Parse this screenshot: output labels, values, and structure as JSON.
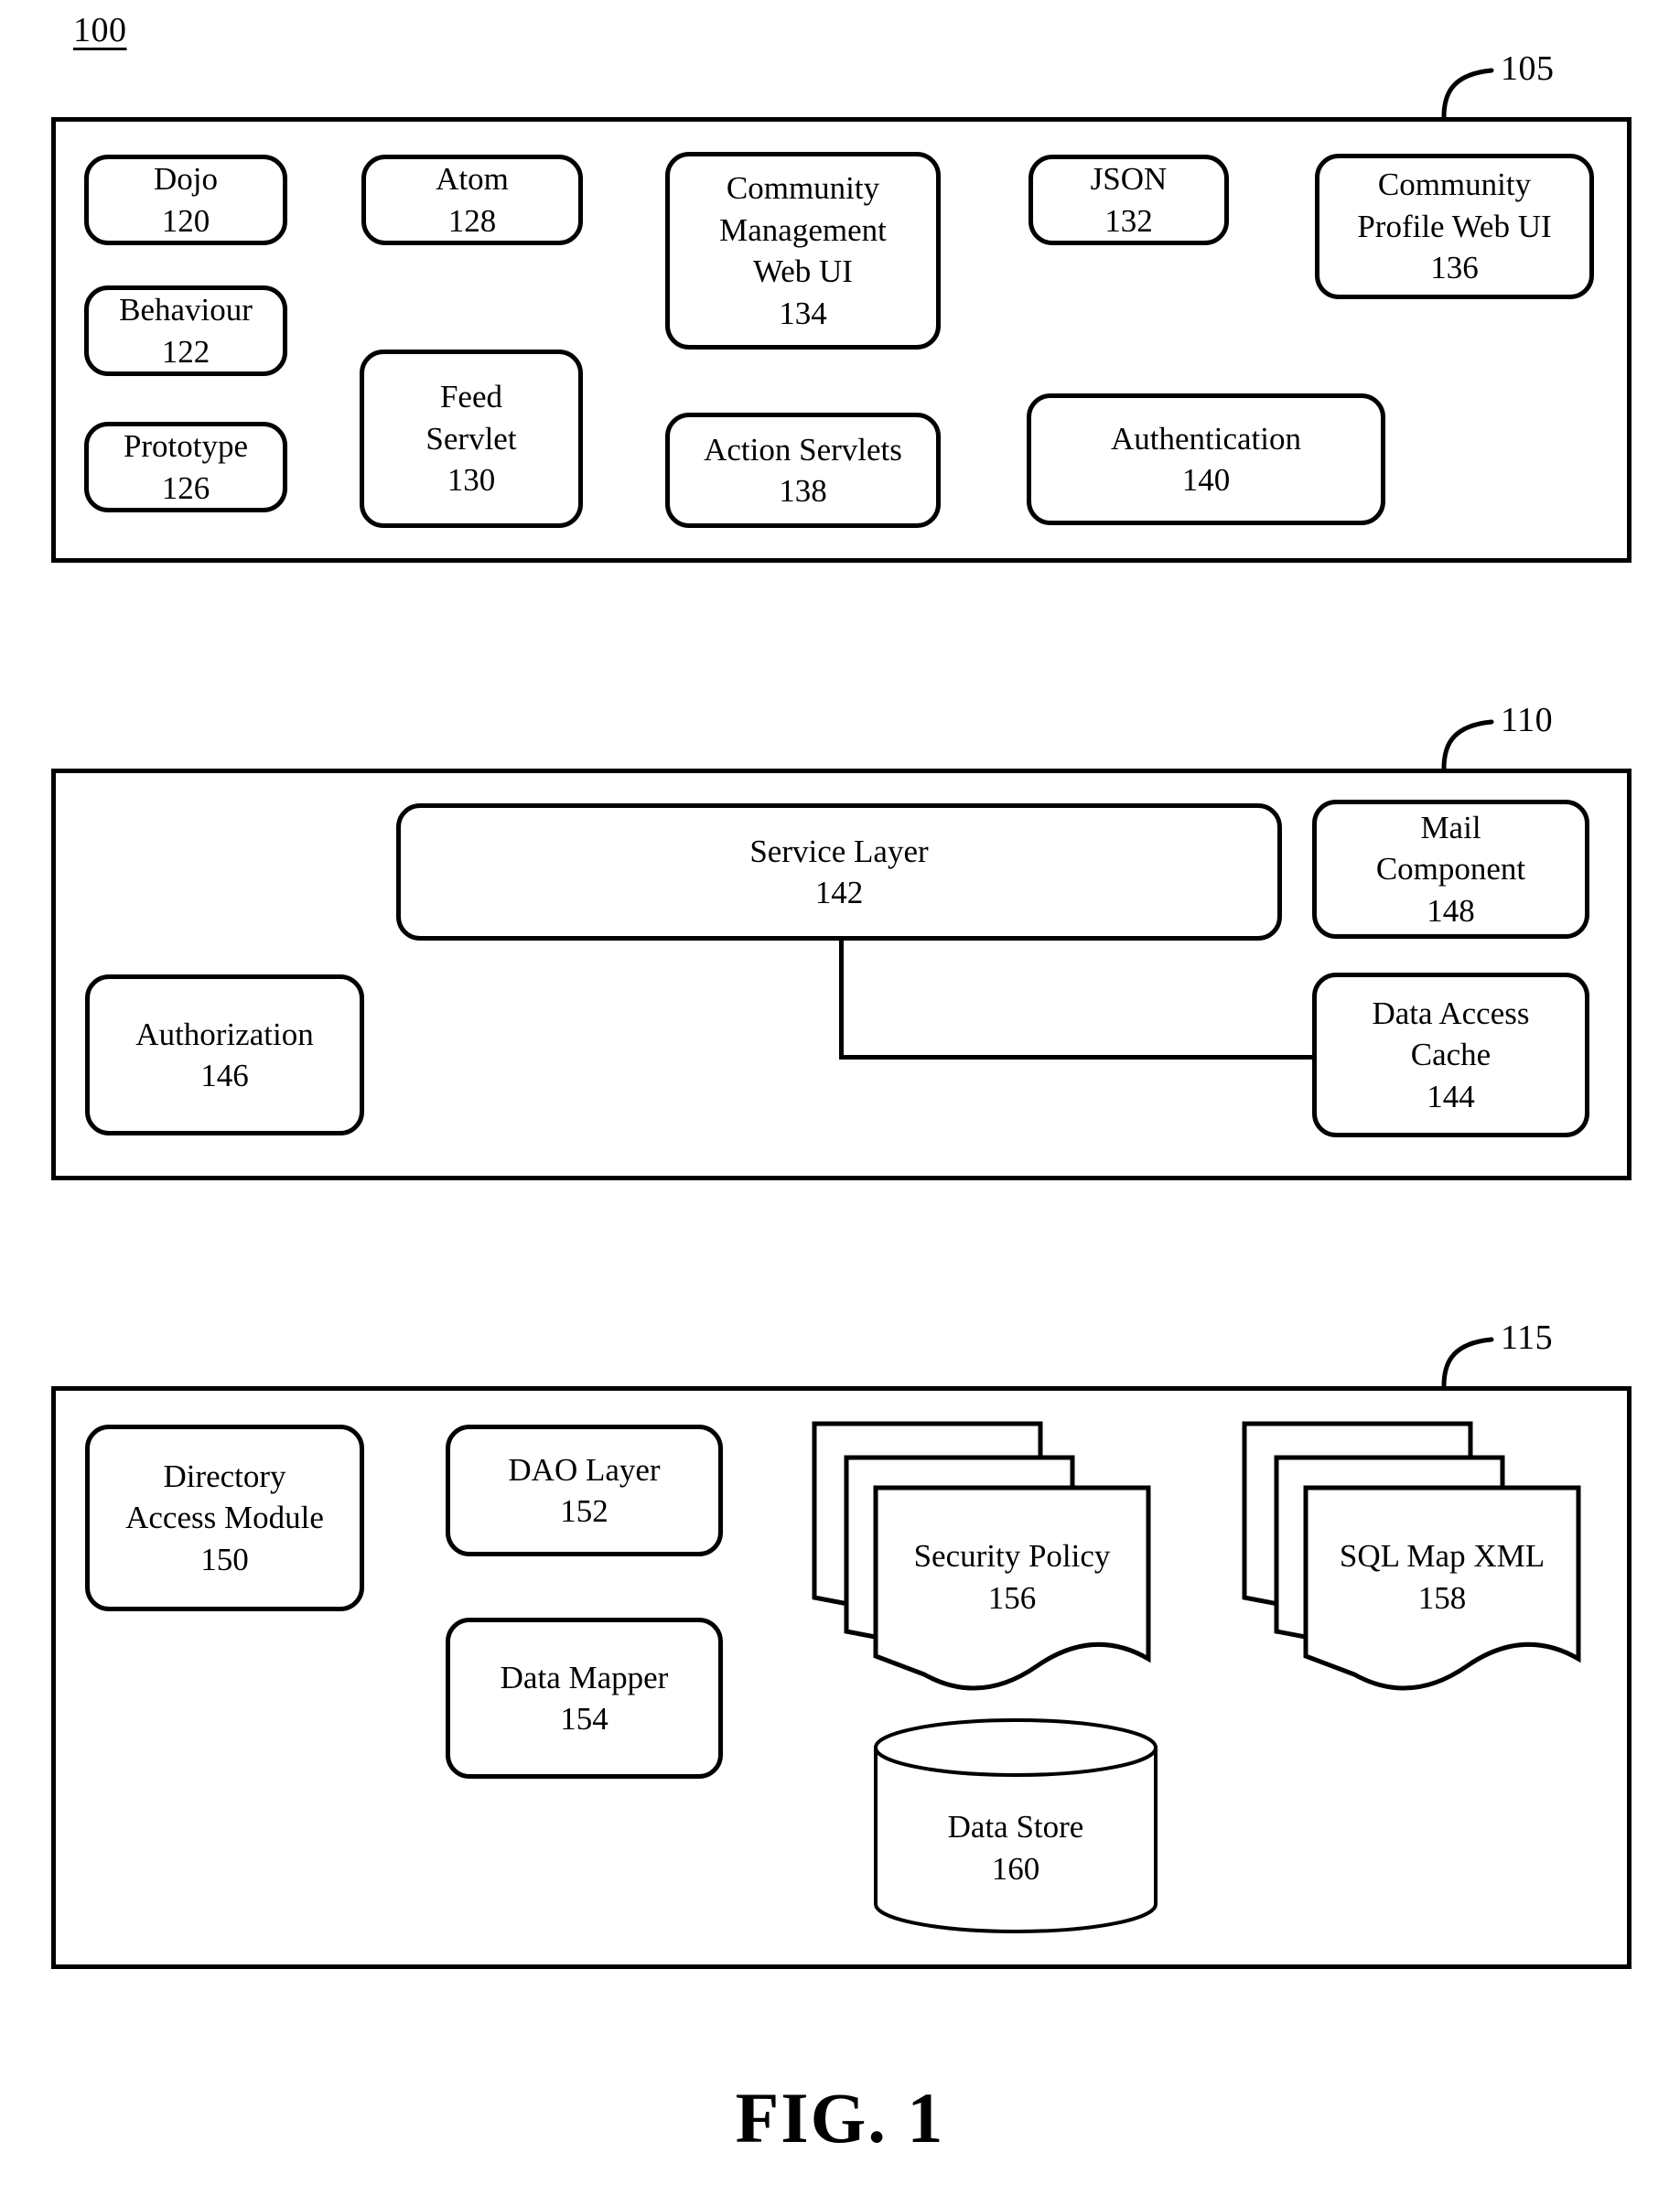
{
  "figure": {
    "number": "100",
    "caption": "FIG. 1",
    "line_color": "#000000",
    "background_color": "#ffffff"
  },
  "layers": [
    {
      "id": "presentation-layer",
      "ref": "105",
      "nodes": [
        {
          "key": "dojo",
          "label": "Dojo",
          "num": "120"
        },
        {
          "key": "behaviour",
          "label": "Behaviour",
          "num": "122"
        },
        {
          "key": "prototype",
          "label": "Prototype",
          "num": "126"
        },
        {
          "key": "atom",
          "label": "Atom",
          "num": "128"
        },
        {
          "key": "feed-servlet",
          "label": "Feed\nServlet",
          "num": "130"
        },
        {
          "key": "community-management-web-ui",
          "label": "Community\nManagement\nWeb UI",
          "num": "134"
        },
        {
          "key": "action-servlets",
          "label": "Action Servlets",
          "num": "138"
        },
        {
          "key": "json",
          "label": "JSON",
          "num": "132"
        },
        {
          "key": "authentication",
          "label": "Authentication",
          "num": "140"
        },
        {
          "key": "community-profile-web-ui",
          "label": "Community\nProfile Web UI",
          "num": "136"
        }
      ]
    },
    {
      "id": "service-layer-container",
      "ref": "110",
      "nodes": [
        {
          "key": "service-layer",
          "label": "Service Layer",
          "num": "142"
        },
        {
          "key": "mail-component",
          "label": "Mail\nComponent",
          "num": "148"
        },
        {
          "key": "authorization",
          "label": "Authorization",
          "num": "146"
        },
        {
          "key": "data-access-cache",
          "label": "Data Access\nCache",
          "num": "144"
        }
      ],
      "connector": {
        "from": "service-layer",
        "to": "data-access-cache",
        "style": "elbow"
      }
    },
    {
      "id": "data-layer-container",
      "ref": "115",
      "nodes": [
        {
          "key": "directory-access-module",
          "label": "Directory\nAccess Module",
          "num": "150"
        },
        {
          "key": "dao-layer",
          "label": "DAO Layer",
          "num": "152"
        },
        {
          "key": "data-mapper",
          "label": "Data Mapper",
          "num": "154"
        }
      ],
      "stacks": [
        {
          "key": "security-policy",
          "label": "Security Policy",
          "num": "156"
        },
        {
          "key": "sql-map-xml",
          "label": "SQL Map XML",
          "num": "158"
        }
      ],
      "cylinders": [
        {
          "key": "data-store",
          "label": "Data Store",
          "num": "160"
        }
      ]
    }
  ]
}
